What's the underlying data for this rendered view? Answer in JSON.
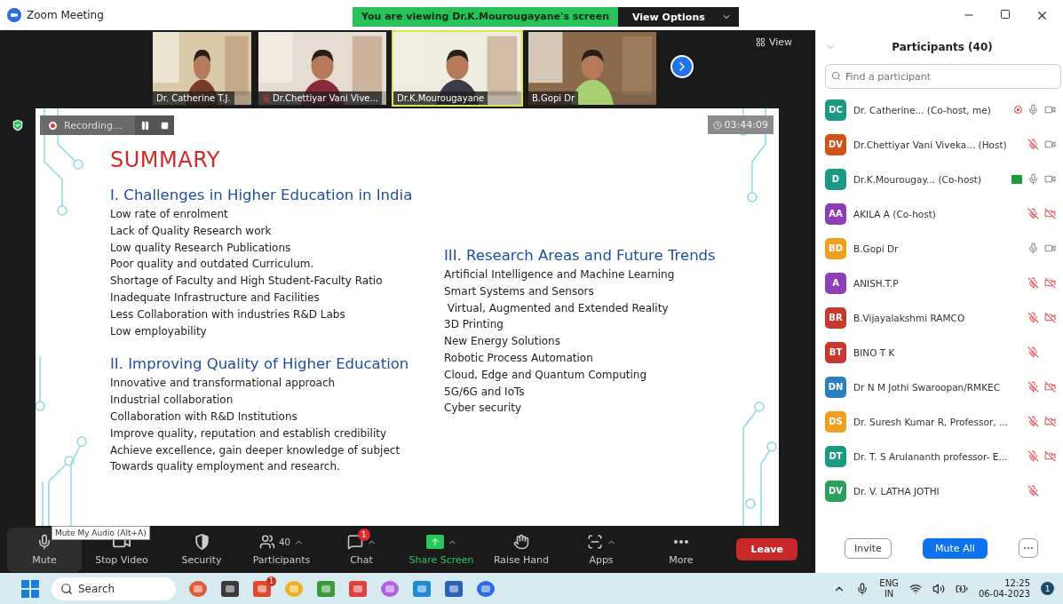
{
  "window": {
    "title": "Zoom Meeting",
    "banner": "You are viewing Dr.K.Mourougayane's screen",
    "view_options": "View Options"
  },
  "videos": [
    {
      "name": "Dr. Catherine T.J.",
      "muted": false,
      "speaking": false
    },
    {
      "name": "Dr.Chettiyar Vani Vive...",
      "muted": true,
      "speaking": false
    },
    {
      "name": "Dr.K.Mourougayane",
      "muted": false,
      "speaking": true
    },
    {
      "name": "B.Gopi Dr",
      "muted": false,
      "speaking": false
    }
  ],
  "view_button": "View",
  "recording": {
    "label": "Recording..."
  },
  "timer": "03:44:09",
  "slide": {
    "title": "SUMMARY",
    "columns": [
      {
        "sections": [
          {
            "heading": "I. Challenges in Higher Education in India",
            "items": [
              "Low rate of enrolment",
              "Lack of Quality Research work",
              "Low quality Research Publications",
              "Poor quality and outdated Curriculum.",
              "Shortage of Faculty and High Student-Faculty Ratio",
              "Inadequate Infrastructure and Facilities",
              "Less Collaboration with industries R&D Labs",
              "Low employability"
            ]
          },
          {
            "heading": "II. Improving Quality of Higher Education",
            "items": [
              "Innovative and transformational approach",
              "Industrial collaboration",
              "Collaboration with R&D Institutions",
              "Improve quality, reputation and establish credibility",
              "Achieve excellence, gain deeper knowledge of subject",
              "Towards quality employment and research."
            ]
          }
        ]
      },
      {
        "sections": [
          {
            "heading": "III. Research Areas and Future Trends",
            "items": [
              "Artificial Intelligence and Machine Learning",
              "Smart Systems and Sensors",
              " Virtual, Augmented and Extended Reality",
              "3D Printing",
              "New Energy Solutions",
              "Robotic Process Automation",
              "Cloud, Edge and Quantum Computing",
              "5G/6G and IoTs",
              "Cyber security"
            ]
          }
        ]
      }
    ]
  },
  "toolbar": [
    {
      "kind": "mic",
      "label": "Mute"
    },
    {
      "kind": "video",
      "label": "Stop Video"
    },
    {
      "kind": "security",
      "label": "Security"
    },
    {
      "kind": "participants",
      "label": "Participants",
      "count": "40",
      "caret": true
    },
    {
      "kind": "chat",
      "label": "Chat",
      "badge": "1",
      "caret": true
    },
    {
      "kind": "share",
      "label": "Share Screen",
      "caret": true
    },
    {
      "kind": "hand",
      "label": "Raise Hand"
    },
    {
      "kind": "apps",
      "label": "Apps",
      "caret": true
    },
    {
      "kind": "more",
      "label": "More"
    }
  ],
  "tooltip": "Mute My Audio (Alt+A)",
  "leave": "Leave",
  "participants": {
    "title": "Participants (40)",
    "search": {
      "placeholder": "Find a participant"
    },
    "rows": [
      {
        "initials": "DC",
        "color": "#1a9a82",
        "name": "Dr. Catherine... (Co-host, me)",
        "recording": true,
        "sharing": false,
        "muted": false,
        "video_off": false
      },
      {
        "initials": "DV",
        "color": "#d0541a",
        "name": "Dr.Chettiyar Vani Viveka... (Host)",
        "muted": true,
        "video_off": false
      },
      {
        "initials": "D",
        "color": "#1a9a82",
        "name": "Dr.K.Mourougay... (Co-host)",
        "recording": false,
        "sharing": true,
        "muted": false,
        "video_off": false
      },
      {
        "initials": "AA",
        "color": "#8e3fb5",
        "name": "AKILA A (Co-host)",
        "muted": true,
        "video_off": true
      },
      {
        "initials": "BD",
        "color": "#f0a020",
        "name": "B.Gopi Dr",
        "muted": false,
        "video_off": false
      },
      {
        "initials": "A",
        "color": "#8e3fb5",
        "name": "ANISH.T.P",
        "muted": true,
        "video_off": true
      },
      {
        "initials": "BR",
        "color": "#c8392d",
        "name": "B.Vijayalakshmi RAMCO",
        "muted": true,
        "video_off": true
      },
      {
        "initials": "BT",
        "color": "#c8392d",
        "name": "BINO T K",
        "muted": true
      },
      {
        "initials": "DN",
        "color": "#2a7fc0",
        "name": "Dr N M Jothi Swaroopan/RMKEC",
        "muted": true,
        "video_off": true
      },
      {
        "initials": "DS",
        "color": "#f0a020",
        "name": "Dr. Suresh Kumar R, Professor, ...",
        "muted": true,
        "video_off": true
      },
      {
        "initials": "DT",
        "color": "#1a9a82",
        "name": "Dr. T. S Arulananth professor- E...",
        "muted": true,
        "video_off": true
      },
      {
        "initials": "DV",
        "color": "#2aa05a",
        "name": "Dr. V. LATHA JOTHI",
        "muted": true
      }
    ],
    "invite": "Invite",
    "mute_all": "Mute All"
  },
  "taskbar": {
    "search": "Search",
    "taskbar_badge": "1",
    "language": "ENG",
    "region": "IN",
    "time": "12:25",
    "date": "06-04-2023",
    "notifications": "1"
  }
}
